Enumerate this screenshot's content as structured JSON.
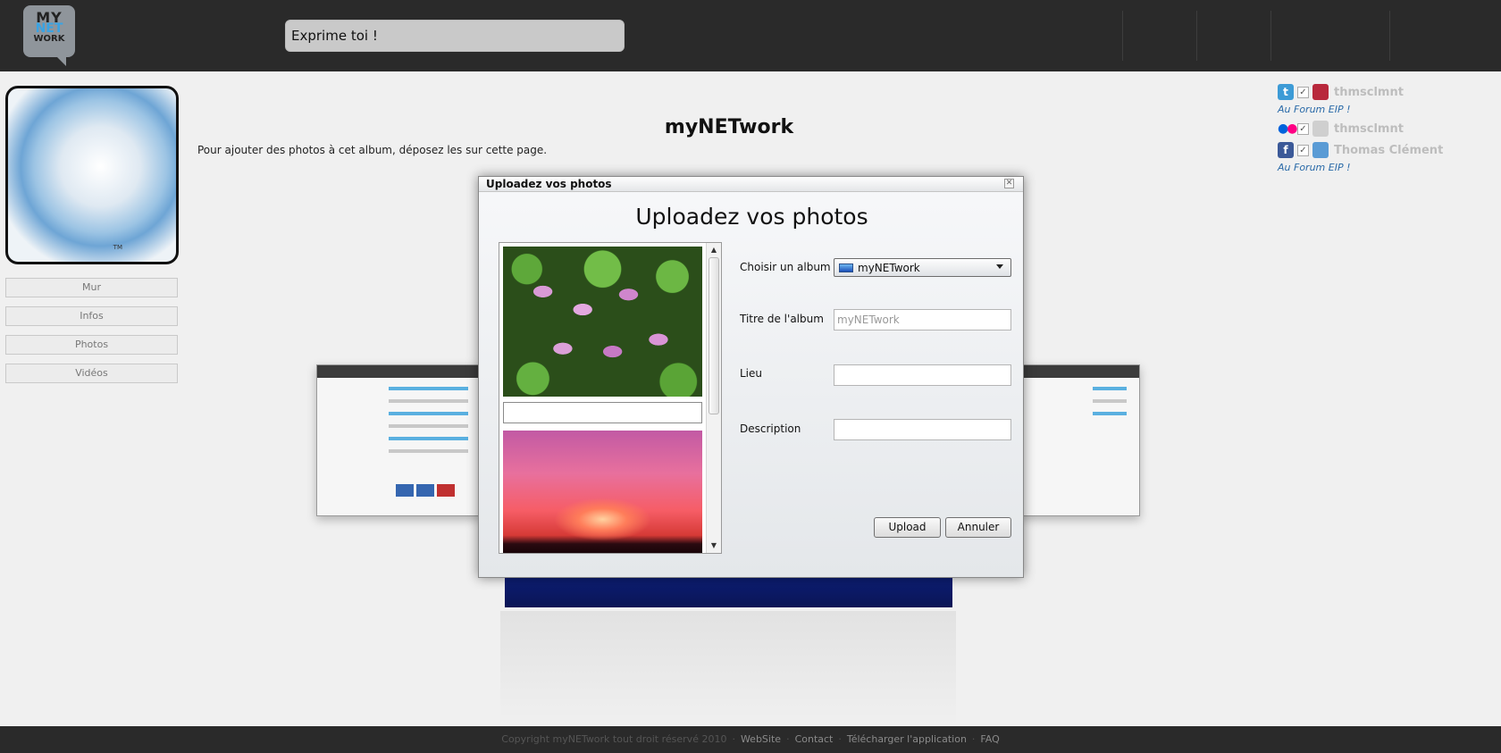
{
  "header": {
    "logo": {
      "line1": "MY",
      "line2": "NET",
      "line3": "WORK"
    },
    "status_placeholder": "Exprime toi !"
  },
  "profile": {
    "picture_mark": "TM",
    "menu": [
      "Mur",
      "Infos",
      "Photos",
      "Vidéos"
    ]
  },
  "page": {
    "title": "myNETwork",
    "hint": "Pour ajouter des photos à cet album, déposez les sur cette page."
  },
  "social": {
    "entries": [
      {
        "network": "twitter",
        "icon": "twitter-icon",
        "color": "#3d9bd6",
        "name": "thmsclmnt",
        "status": "Au Forum EIP !"
      },
      {
        "network": "flickr",
        "icon": "flickr-icon",
        "color": "#0063dc",
        "name": "thmsclmnt",
        "status": ""
      },
      {
        "network": "facebook",
        "icon": "facebook-icon",
        "color": "#3b5998",
        "name": "Thomas Clément",
        "status": "Au Forum EIP !"
      }
    ]
  },
  "modal": {
    "window_title": "Uploadez vos photos",
    "heading": "Uploadez vos photos",
    "album_label": "Choisir un album",
    "album_selected": "myNETwork",
    "title_label": "Titre de l'album",
    "title_value": "myNETwork",
    "place_label": "Lieu",
    "place_value": "",
    "description_label": "Description",
    "description_value": "",
    "upload_label": "Upload",
    "cancel_label": "Annuler"
  },
  "footer": {
    "copyright": "Copyright myNETwork tout droit réservé 2010",
    "links": [
      "WebSite",
      "Contact",
      "Télécharger l'application",
      "FAQ"
    ]
  }
}
